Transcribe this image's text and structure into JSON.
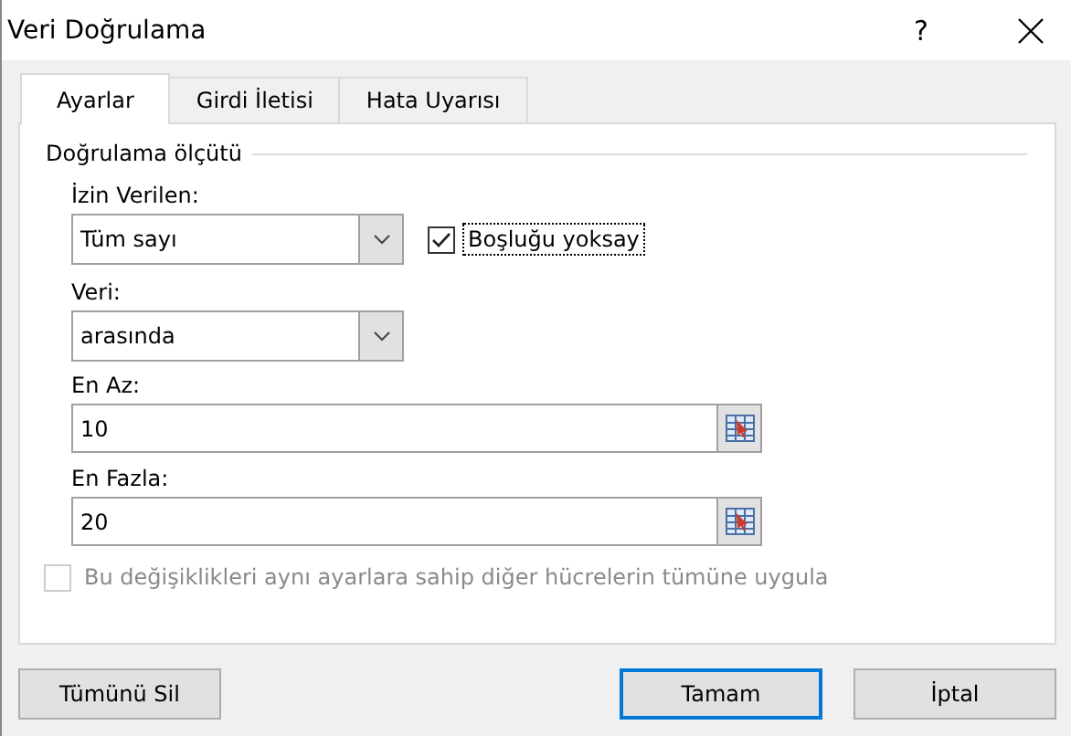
{
  "window": {
    "title": "Veri Doğrulama",
    "help": "?"
  },
  "tabs": [
    {
      "label": "Ayarlar",
      "selected": true
    },
    {
      "label": "Girdi İletisi",
      "selected": false
    },
    {
      "label": "Hata Uyarısı",
      "selected": false
    }
  ],
  "group": {
    "title": "Doğrulama ölçütü"
  },
  "allow": {
    "label": "İzin Verilen:",
    "value": "Tüm sayı"
  },
  "ignore_blank": {
    "label": "Boşluğu yoksay",
    "checked": true,
    "focused": true
  },
  "data": {
    "label": "Veri:",
    "value": "arasında"
  },
  "minimum": {
    "label": "En Az:",
    "value": "10"
  },
  "maximum": {
    "label": "En Fazla:",
    "value": "20"
  },
  "apply_all": {
    "label": "Bu değişiklikleri aynı ayarlara sahip diğer hücrelerin tümüne uygula",
    "checked": false,
    "disabled": true
  },
  "buttons": [
    {
      "label": "Tümünü Sil",
      "default": false
    },
    {
      "label": "Tamam",
      "default": true
    },
    {
      "label": "İptal",
      "default": false
    }
  ]
}
